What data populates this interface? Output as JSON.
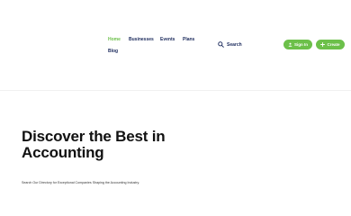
{
  "nav": {
    "items": [
      {
        "label": "Home",
        "active": true
      },
      {
        "label": "Businesses",
        "active": false
      },
      {
        "label": "Events",
        "active": false
      },
      {
        "label": "Plans",
        "active": false
      },
      {
        "label": "Blog",
        "active": false
      }
    ]
  },
  "search": {
    "label": "Search",
    "icon": "search-icon"
  },
  "actions": {
    "signin_label": "Sign In",
    "signin_icon": "user-icon",
    "create_label": "Create",
    "create_icon": "plus-icon"
  },
  "hero": {
    "title": "Discover the Best in Accounting",
    "subtitle": "Search Our Directory for Exceptional Companies Shaping the Accounting Industry."
  },
  "colors": {
    "accent": "#6cc04a",
    "nav_text": "#1b2a5c",
    "heading": "#111111"
  }
}
